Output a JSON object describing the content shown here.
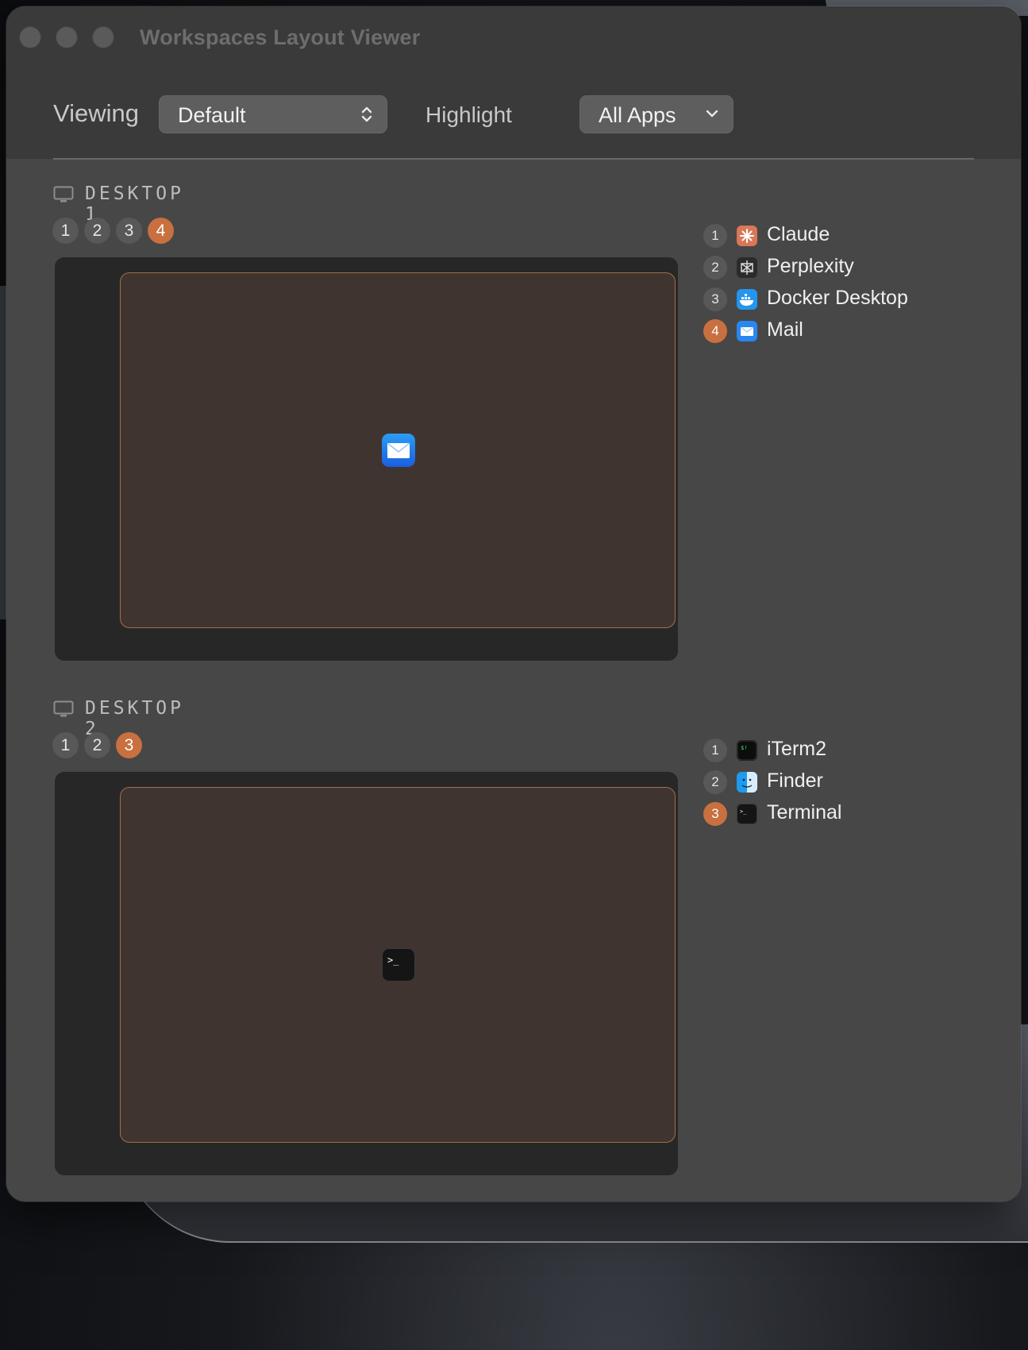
{
  "window": {
    "title": "Workspaces Layout Viewer"
  },
  "toolbar": {
    "viewing_label": "Viewing",
    "viewing_value": "Default",
    "highlight_label": "Highlight",
    "highlight_value": "All Apps"
  },
  "desktops": [
    {
      "title": "DESKTOP 1",
      "badges": [
        "1",
        "2",
        "3",
        "4"
      ],
      "active": "4",
      "preview_icon": "mail-icon",
      "apps": [
        {
          "num": "1",
          "name": "Claude",
          "icon": "claude-icon"
        },
        {
          "num": "2",
          "name": "Perplexity",
          "icon": "perplexity-icon"
        },
        {
          "num": "3",
          "name": "Docker Desktop",
          "icon": "docker-icon"
        },
        {
          "num": "4",
          "name": "Mail",
          "icon": "mail-icon"
        }
      ]
    },
    {
      "title": "DESKTOP 2",
      "badges": [
        "1",
        "2",
        "3"
      ],
      "active": "3",
      "preview_icon": "terminal-icon",
      "apps": [
        {
          "num": "1",
          "name": "iTerm2",
          "icon": "iterm-icon"
        },
        {
          "num": "2",
          "name": "Finder",
          "icon": "finder-icon"
        },
        {
          "num": "3",
          "name": "Terminal",
          "icon": "terminal-icon"
        }
      ]
    }
  ],
  "colors": {
    "accent": "#c8703f",
    "window_bg": "#474747",
    "preview_bg": "#272727",
    "frame_fill": "#403430",
    "frame_border": "#a26f48"
  }
}
